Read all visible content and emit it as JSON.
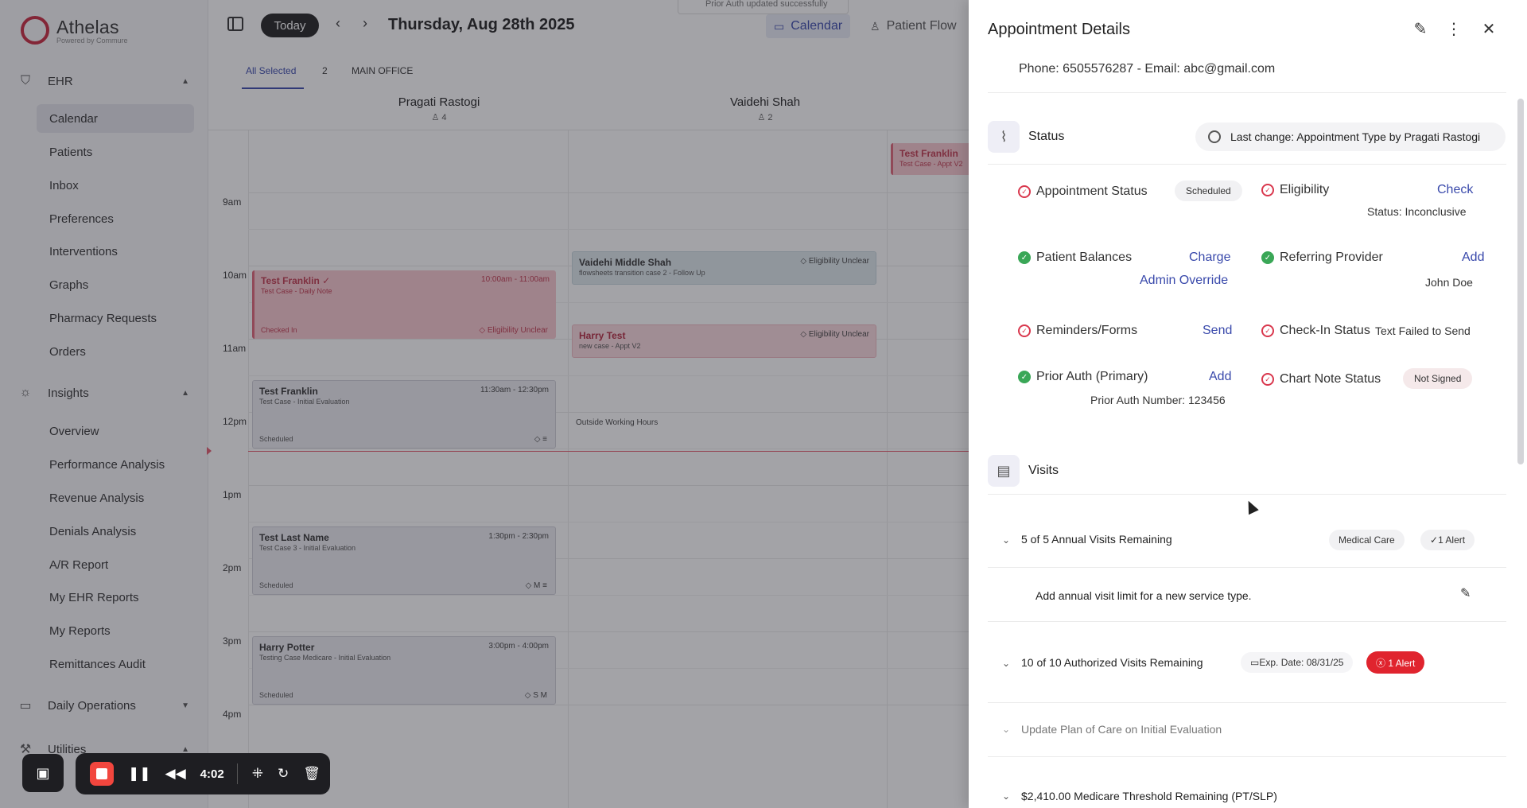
{
  "brand": {
    "name": "Athelas",
    "subtitle": "Powered by Commure",
    "color": "#c8283f"
  },
  "sidebar": {
    "sections": [
      {
        "label": "EHR",
        "icon": "shield-icon"
      },
      {
        "label": "Insights",
        "icon": "lightbulb-icon"
      },
      {
        "label": "Daily Operations",
        "icon": "calendar-icon"
      },
      {
        "label": "Utilities",
        "icon": "wrench-icon"
      }
    ],
    "ehr_items": [
      "Calendar",
      "Patients",
      "Inbox",
      "Preferences",
      "Interventions",
      "Graphs",
      "Pharmacy Requests",
      "Orders"
    ],
    "insights_items": [
      "Overview",
      "Performance Analysis",
      "Revenue Analysis",
      "Denials Analysis",
      "A/R Report",
      "My EHR Reports",
      "My Reports",
      "Remittances Audit"
    ],
    "active_item": "Calendar"
  },
  "calendar": {
    "today_label": "Today",
    "date": "Thursday, Aug 28th 2025",
    "toast": "Prior Auth updated successfully",
    "views": [
      "Calendar",
      "Patient Flow"
    ],
    "filters": {
      "all_selected": "All Selected",
      "count": "2",
      "location": "MAIN OFFICE"
    },
    "providers": [
      {
        "name": "Pragati Rastogi",
        "count": "4"
      },
      {
        "name": "Vaidehi Shah",
        "count": "2"
      }
    ],
    "hours": [
      "9am",
      "10am",
      "11am",
      "12pm",
      "1pm",
      "2pm",
      "3pm",
      "4pm"
    ],
    "outside_hours": "Outside Working Hours",
    "appointments": [
      {
        "title": "Test Franklin ✓",
        "time": "10:00am - 11:00am",
        "sub": "Test Case - Daily Note",
        "status": "Checked In",
        "tags": "◇ Eligibility Unclear"
      },
      {
        "title": "Test Franklin",
        "time": "11:30am - 12:30pm",
        "sub": "Test Case - Initial Evaluation",
        "status": "Scheduled",
        "tags": "◇ ≡"
      },
      {
        "title": "Test Last Name",
        "time": "1:30pm - 2:30pm",
        "sub": "Test Case 3 - Initial Evaluation",
        "status": "Scheduled",
        "tags": "◇ M ≡"
      },
      {
        "title": "Harry Potter",
        "time": "3:00pm - 4:00pm",
        "sub": "Testing Case Medicare - Initial Evaluation",
        "status": "Scheduled",
        "tags": "◇ S M"
      },
      {
        "title": "Vaidehi Middle Shah",
        "sub": "flowsheets transition case 2 - Follow Up",
        "tags": "◇ Eligibility Unclear"
      },
      {
        "title": "Harry Test",
        "sub": "new case - Appt V2",
        "tags": "◇ Eligibility Unclear"
      },
      {
        "title": "Test Franklin",
        "sub": "Test Case - Appt V2"
      }
    ]
  },
  "recorder": {
    "time": "4:02"
  },
  "panel": {
    "title": "Appointment Details",
    "contact": "Phone: 6505576287 - Email: abc@gmail.com",
    "status_section": {
      "label": "Status",
      "last_change": "Last change: Appointment Type by Pragati Rastogi",
      "appointment_status": {
        "label": "Appointment Status",
        "value": "Scheduled"
      },
      "eligibility": {
        "label": "Eligibility",
        "action": "Check",
        "detail": "Status: Inconclusive"
      },
      "patient_balances": {
        "label": "Patient Balances",
        "action": "Charge",
        "action2": "Admin Override"
      },
      "referring_provider": {
        "label": "Referring Provider",
        "action": "Add",
        "detail": "John Doe"
      },
      "reminders_forms": {
        "label": "Reminders/Forms",
        "action": "Send"
      },
      "checkin_status": {
        "label": "Check-In Status",
        "value": "Text Failed to Send"
      },
      "prior_auth": {
        "label": "Prior Auth (Primary)",
        "action": "Add",
        "detail": "Prior Auth Number: 123456"
      },
      "chart_note_status": {
        "label": "Chart Note Status",
        "value": "Not Signed"
      }
    },
    "visits_section": {
      "label": "Visits",
      "rows": [
        {
          "label": "5 of 5 Annual Visits Remaining",
          "tag": "Medical Care",
          "alert": "1 Alert"
        },
        {
          "label": "Add annual visit limit for a new service type."
        },
        {
          "label": "10 of 10 Authorized Visits Remaining",
          "tag": "Exp. Date: 08/31/25",
          "alert": "ⓧ 1 Alert"
        },
        {
          "label": "Update Plan of Care on Initial Evaluation"
        },
        {
          "label": "$2,410.00 Medicare Threshold Remaining (PT/SLP)"
        }
      ]
    }
  },
  "colors": {
    "accent": "#3949ab",
    "alert": "#e0242e",
    "ok": "#3aa757",
    "error": "#d9374d"
  }
}
